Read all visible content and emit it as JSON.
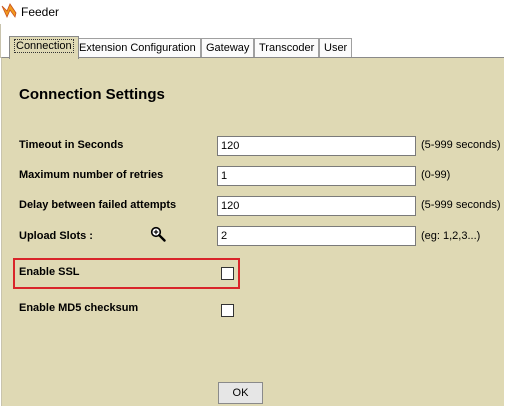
{
  "window": {
    "title": "Feeder",
    "icon": "feeder-app-icon"
  },
  "tabs": [
    {
      "label": "Connection",
      "active": true
    },
    {
      "label": "Extension Configuration",
      "active": false
    },
    {
      "label": "Gateway",
      "active": false
    },
    {
      "label": "Transcoder",
      "active": false
    },
    {
      "label": "User",
      "active": false
    }
  ],
  "section": {
    "heading": "Connection Settings"
  },
  "fields": [
    {
      "label": "Timeout in Seconds",
      "value": "120",
      "hint": "(5-999 seconds)"
    },
    {
      "label": "Maximum number of retries",
      "value": "1",
      "hint": "(0-99)"
    },
    {
      "label": "Delay between failed attempts",
      "value": "120",
      "hint": "(5-999 seconds)"
    },
    {
      "label": "Upload Slots :",
      "value": "2",
      "hint": "(eg: 1,2,3...)"
    }
  ],
  "checkboxes": [
    {
      "label": "Enable SSL",
      "checked": false,
      "highlighted": true
    },
    {
      "label": "Enable MD5 checksum",
      "checked": false,
      "highlighted": false
    }
  ],
  "buttons": {
    "ok": "OK"
  },
  "colors": {
    "panel": "#dfd9b4",
    "highlight": "#d9252a"
  }
}
